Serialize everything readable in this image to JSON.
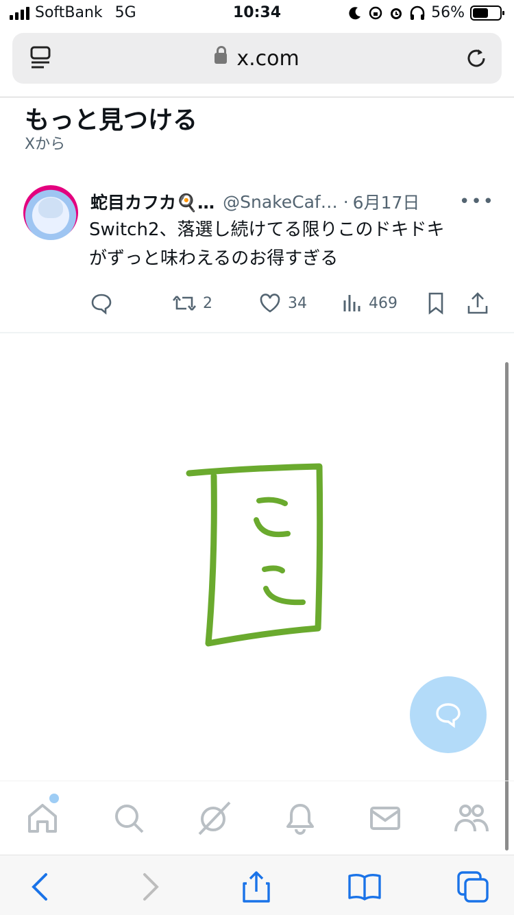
{
  "status": {
    "carrier": "SoftBank",
    "network": "5G",
    "time": "10:34",
    "battery": "56%"
  },
  "browser": {
    "url": "x.com"
  },
  "section": {
    "title": "もっと見つける",
    "subtitle": "Xから"
  },
  "tweet": {
    "name": "蛇目カフカ🍳…",
    "handle": "@SnakeCaf…",
    "date": "6月17日",
    "text_line1": "Switch2、落選し続けてる限りこのドキドキ",
    "text_line2": "がずっと味わえるのお得すぎる",
    "retweets": "2",
    "likes": "34",
    "views": "469"
  },
  "annotation": {
    "text_line1": "こ",
    "text_line2": "こ",
    "color": "#6aaa2e"
  },
  "colors": {
    "accent": "#1d9bf0",
    "fab": "#b3dbf9",
    "muted": "#536471"
  }
}
